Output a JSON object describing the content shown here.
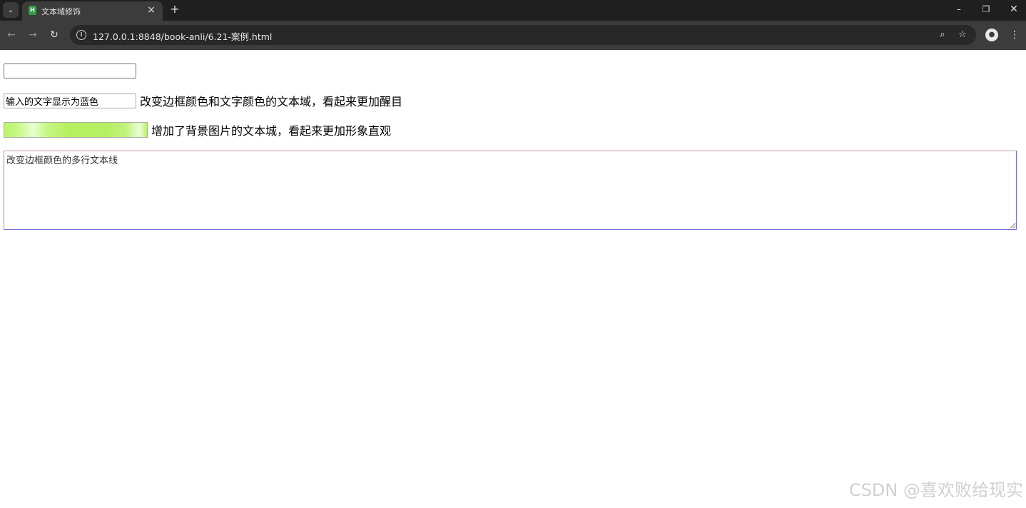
{
  "browser": {
    "tab_title": "文本域修饰",
    "tab_favicon_letter": "H",
    "tab_close": "×",
    "new_tab": "+",
    "url": "127.0.0.1:8848/book-anli/6.21-案例.html",
    "window_minimize": "–",
    "window_restore": "❐",
    "window_close": "✕",
    "nav_back": "←",
    "nav_forward": "→",
    "nav_reload": "↻",
    "info_glyph": "i",
    "zoom_glyph": "⌕",
    "star_glyph": "☆",
    "profile_glyph": "●",
    "menu_glyph": "⋮",
    "tab_search_glyph": "⌄"
  },
  "page": {
    "input1": {
      "value": "",
      "placeholder": ""
    },
    "input2": {
      "value": "输入的文字显示为蓝色",
      "label": "改变边框颜色和文字颜色的文本域，看起来更加醒目"
    },
    "input3": {
      "value": "",
      "label": "增加了背景图片的文本城，看起来更加形象直观"
    },
    "textarea": {
      "value": "改变边框颜色的多行文本线"
    },
    "watermark": "CSDN @喜欢败给现实"
  },
  "colors": {
    "tabstrip_bg": "#1f1f1f",
    "toolbar_bg": "#3c3c3c",
    "omnibox_bg": "#282828",
    "input_bg_green": "#b9f56a",
    "textarea_border": "#6b6bd6"
  }
}
